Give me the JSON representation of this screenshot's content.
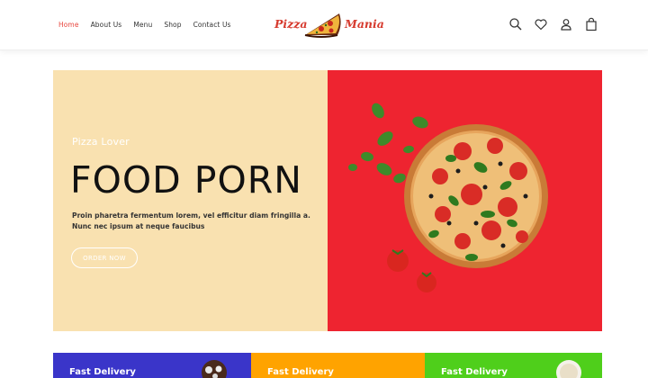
{
  "nav": {
    "items": [
      {
        "label": "Home",
        "active": true
      },
      {
        "label": "About Us",
        "active": false
      },
      {
        "label": "Menu",
        "active": false
      },
      {
        "label": "Shop",
        "active": false
      },
      {
        "label": "Contact Us",
        "active": false
      }
    ],
    "active_color": "#e8473f"
  },
  "logo": {
    "left_text": "Pizza",
    "right_text": "Mania",
    "color": "#d63a2e"
  },
  "header_icons": [
    "search-icon",
    "heart-icon",
    "user-icon",
    "shopping-bag-icon"
  ],
  "hero": {
    "kicker": "Pizza Lover",
    "headline": "FOOD PORN",
    "blurb": "Proin pharetra fermentum lorem, vel efficitur diam fringilla a. Nunc nec ipsum at neque faucibus",
    "button_label": "ORDER NOW",
    "left_bg": "#f9e1b0",
    "right_bg": "#ee2430"
  },
  "features": [
    {
      "title": "Fast Delivery",
      "color": "#3a35c9"
    },
    {
      "title": "Fast Delivery",
      "color": "#ffa300"
    },
    {
      "title": "Fast Delivery",
      "color": "#4fcf1b"
    }
  ]
}
